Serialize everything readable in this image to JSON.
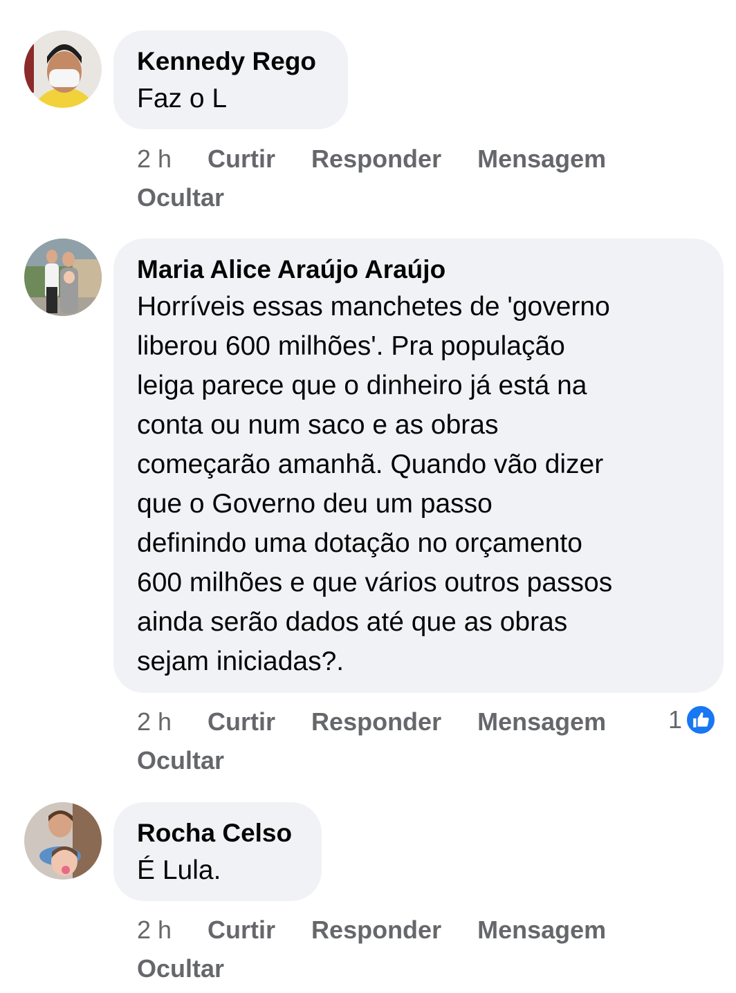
{
  "comments": [
    {
      "author": "Kennedy Rego",
      "text": "Faz o L",
      "time": "2 h",
      "actions": [
        "Curtir",
        "Responder",
        "Mensagem",
        "Ocultar"
      ]
    },
    {
      "author": "Maria Alice Araújo Araújo",
      "text": "Horríveis essas manchetes de 'governo\nliberou 600 milhões'. Pra população\nleiga parece que o dinheiro já está na\nconta ou num saco e as obras\ncomeçarão amanhã. Quando vão dizer\nque o Governo   deu um passo\ndefinindo uma dotação no orçamento\n600 milhões e que vários outros passos\nainda serão dados até que as obras\nsejam iniciadas?.",
      "time": "2 h",
      "actions": [
        "Curtir",
        "Responder",
        "Mensagem",
        "Ocultar"
      ],
      "reaction_count": "1",
      "reaction_icon": "like-icon",
      "reaction_color": "#1877f2"
    },
    {
      "author": "Rocha Celso",
      "text": "É Lula.",
      "time": "2 h",
      "actions": [
        "Curtir",
        "Responder",
        "Mensagem",
        "Ocultar"
      ]
    }
  ],
  "colors": {
    "bubble_bg": "#f0f2f5",
    "meta_text": "#65676b",
    "name_text": "#050505"
  }
}
